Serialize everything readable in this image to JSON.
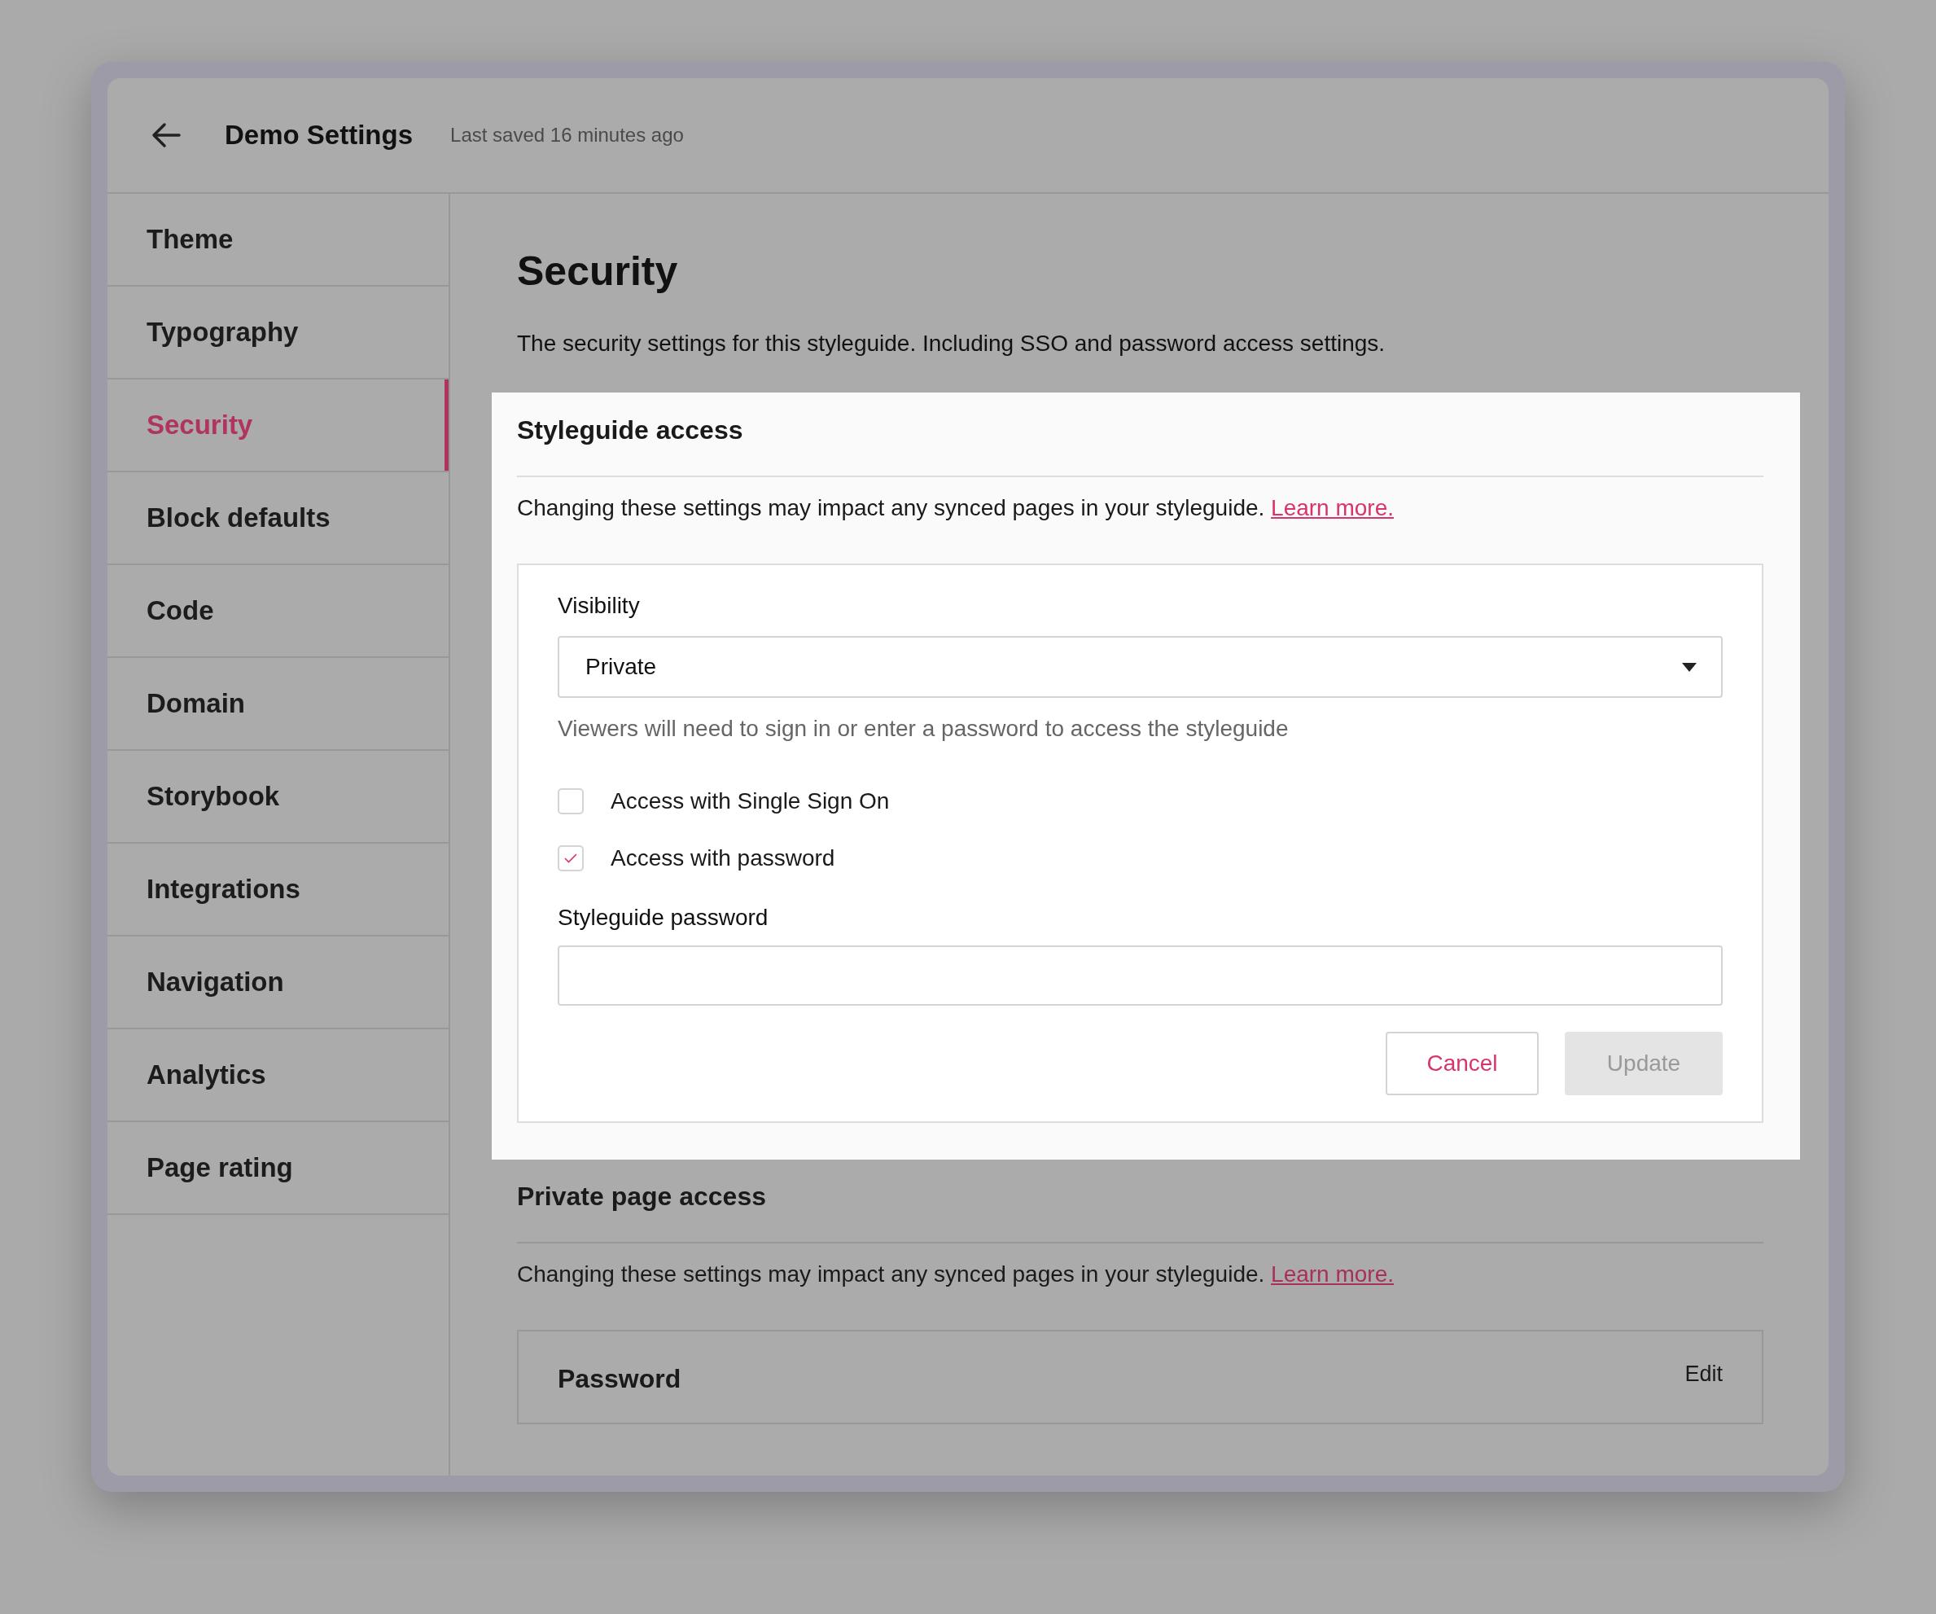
{
  "header": {
    "title": "Demo Settings",
    "last_saved": "Last saved 16 minutes ago"
  },
  "sidebar": {
    "items": [
      {
        "label": "Theme",
        "selected": false
      },
      {
        "label": "Typography",
        "selected": false
      },
      {
        "label": "Security",
        "selected": true
      },
      {
        "label": "Block defaults",
        "selected": false
      },
      {
        "label": "Code",
        "selected": false
      },
      {
        "label": "Domain",
        "selected": false
      },
      {
        "label": "Storybook",
        "selected": false
      },
      {
        "label": "Integrations",
        "selected": false
      },
      {
        "label": "Navigation",
        "selected": false
      },
      {
        "label": "Analytics",
        "selected": false
      },
      {
        "label": "Page rating",
        "selected": false
      }
    ]
  },
  "page": {
    "title": "Security",
    "description": "The security settings for this styleguide. Including SSO and password access settings."
  },
  "styleguide_access": {
    "heading": "Styleguide access",
    "notice": "Changing these settings may impact any synced pages in your styleguide.",
    "link": "Learn more.",
    "visibility": {
      "label": "Visibility",
      "value": "Private",
      "help": "Viewers will need to sign in or enter a password to access the styleguide"
    },
    "options": [
      {
        "label": "Access with Single Sign On",
        "checked": false
      },
      {
        "label": "Access with password",
        "checked": true
      }
    ],
    "password_field": {
      "label": "Styleguide password"
    },
    "buttons": [
      {
        "label": "Cancel",
        "disabled": false
      },
      {
        "label": "Update",
        "disabled": true
      }
    ]
  },
  "private_page_access": {
    "heading": "Private page access",
    "notice": "Changing these settings may impact any synced pages in your styleguide.",
    "link": "Learn more.",
    "row": {
      "label": "Password",
      "action": "Edit"
    }
  }
}
